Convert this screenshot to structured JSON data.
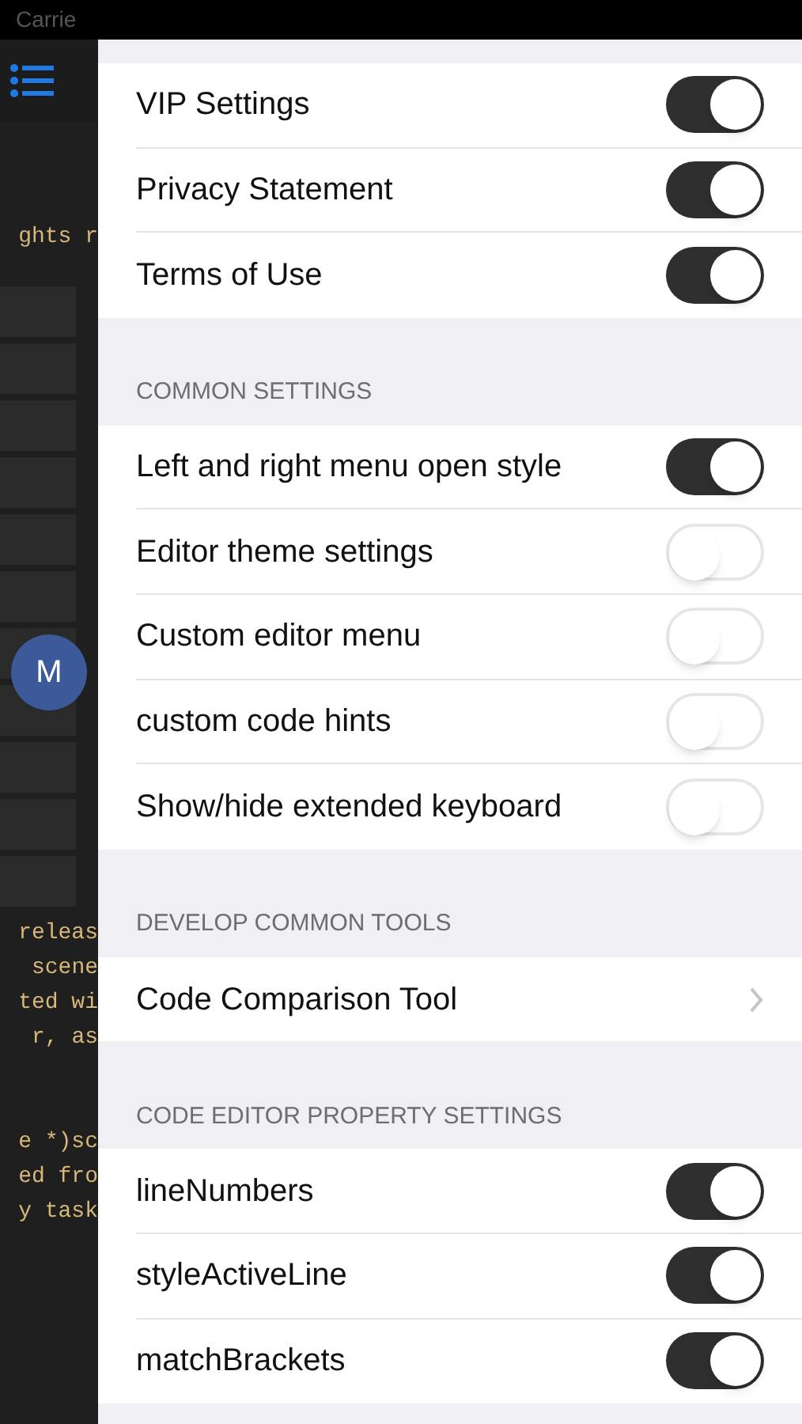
{
  "status_bar": {
    "carrier": "Carrie"
  },
  "editor": {
    "code_top": [
      "ghts r"
    ],
    "avatar": "M",
    "code_bottom": [
      [
        "releas",
        "scene",
        "ted wi",
        "r, as"
      ],
      [
        "e *)sc",
        "ed fro",
        "y task"
      ]
    ]
  },
  "sections": [
    {
      "rows": [
        {
          "kind": "toggle",
          "label": "VIP Settings",
          "on": true
        },
        {
          "kind": "toggle",
          "label": "Privacy Statement",
          "on": true
        },
        {
          "kind": "toggle",
          "label": "Terms of Use",
          "on": true
        }
      ]
    },
    {
      "header": "COMMON SETTINGS",
      "rows": [
        {
          "kind": "toggle",
          "label": "Left and right menu open style",
          "on": true
        },
        {
          "kind": "toggle",
          "label": "Editor theme settings",
          "on": false
        },
        {
          "kind": "toggle",
          "label": "Custom editor menu",
          "on": false
        },
        {
          "kind": "toggle",
          "label": "custom code hints",
          "on": false
        },
        {
          "kind": "toggle",
          "label": "Show/hide extended keyboard",
          "on": false
        }
      ]
    },
    {
      "header": "DEVELOP COMMON TOOLS",
      "rows": [
        {
          "kind": "link",
          "label": "Code Comparison Tool"
        }
      ]
    },
    {
      "header": "CODE EDITOR PROPERTY SETTINGS",
      "rows": [
        {
          "kind": "toggle",
          "label": "lineNumbers",
          "on": true
        },
        {
          "kind": "toggle",
          "label": "styleActiveLine",
          "on": true
        },
        {
          "kind": "toggle",
          "label": "matchBrackets",
          "on": true
        }
      ]
    }
  ]
}
